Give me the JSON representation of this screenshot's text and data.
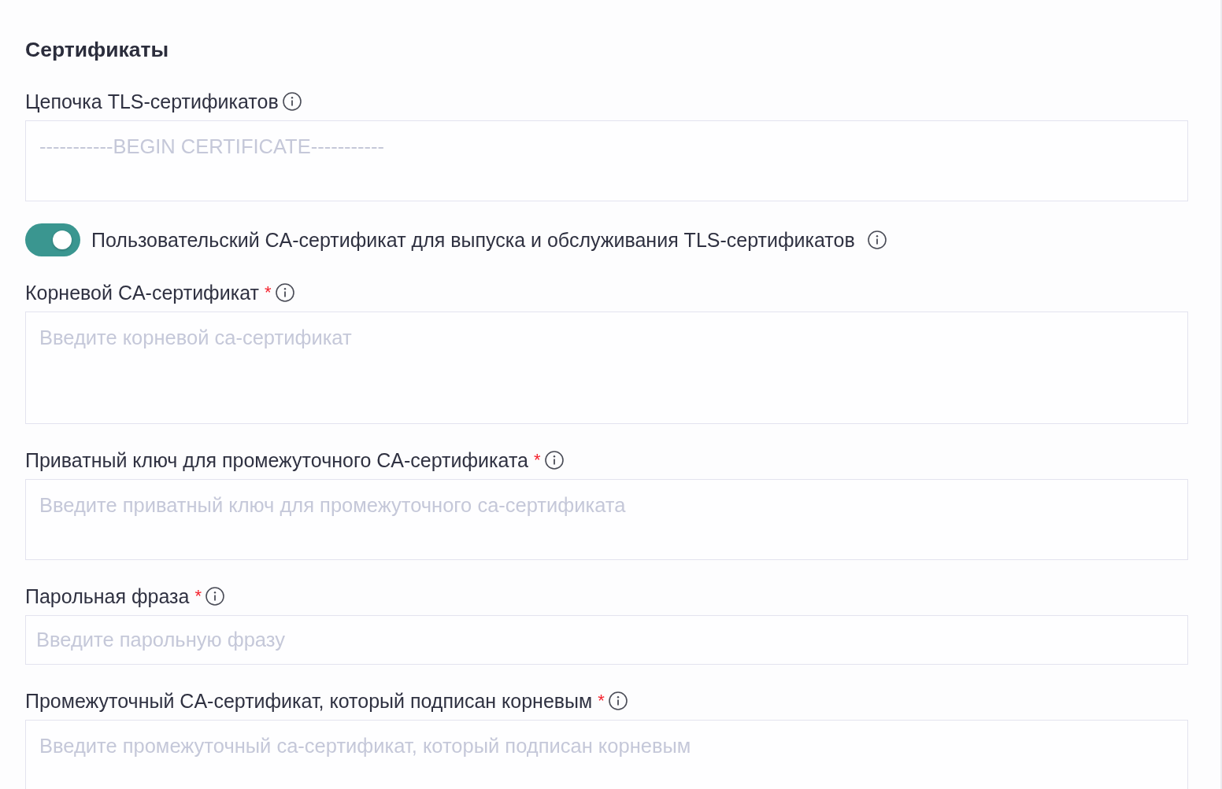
{
  "section": {
    "title": "Сертификаты"
  },
  "items": [
    {
      "kind": "textarea",
      "label": "Цепочка TLS-сертификатов",
      "placeholder": "-----------BEGIN CERTIFICATE-----------"
    },
    {
      "kind": "toggle",
      "label": "Пользовательский CA-сертификат для выпуска и обслуживания TLS-сертификатов",
      "on": true
    },
    {
      "kind": "textarea",
      "label": "Корневой CA-сертификат",
      "required_mark": "*",
      "placeholder": "Введите корневой ca-сертификат"
    },
    {
      "kind": "textarea",
      "label": "Приватный ключ для промежуточного CA-сертификата",
      "required_mark": "*",
      "placeholder": "Введите приватный ключ для промежуточного ca-сертификата"
    },
    {
      "kind": "input",
      "label": "Парольная фраза",
      "required_mark": "*",
      "placeholder": "Введите парольную фразу"
    },
    {
      "kind": "textarea",
      "label": "Промежуточный CA-сертификат, который подписан корневым",
      "required_mark": "*",
      "placeholder": "Введите промежуточный ca-сертификат, который подписан корневым"
    }
  ]
}
